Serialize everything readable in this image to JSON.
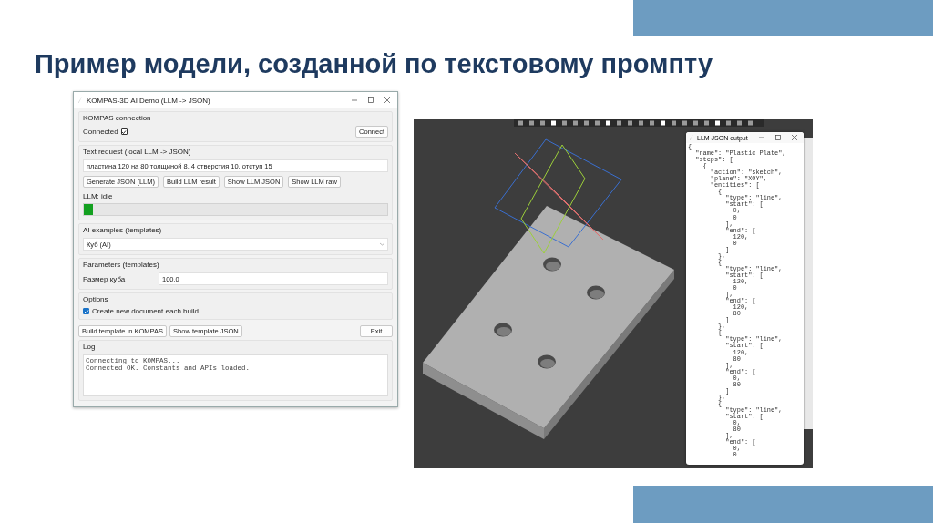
{
  "slide_title": "Пример модели, созданной по текстовому промпту",
  "app_window": {
    "title": "KOMPAS-3D AI Demo (LLM -> JSON)",
    "connection": {
      "heading": "KOMPAS connection",
      "label": "Connected",
      "checked": true,
      "button": "Connect"
    },
    "text_request": {
      "heading": "Text request (local LLM -> JSON)",
      "value": "пластина 120 на 80 толщиной 8, 4 отверстия 10, отступ 15",
      "buttons": [
        "Generate JSON (LLM)",
        "Build LLM result",
        "Show LLM JSON",
        "Show LLM raw"
      ],
      "status": "LLM: idle",
      "level": 0.03
    },
    "examples": {
      "heading": "AI examples (templates)",
      "value": "Куб (AI)"
    },
    "parameters": {
      "heading": "Parameters (templates)",
      "label": "Размер куба",
      "value": "100.0"
    },
    "options": {
      "heading": "Options",
      "label": "Create new document each build",
      "checked": true
    },
    "buttons": [
      "Build template in KOMPAS",
      "Show template JSON",
      "Exit"
    ],
    "log": {
      "heading": "Log",
      "lines": [
        "Connecting to KOMPAS...",
        "Connected OK. Constants and APIs loaded."
      ]
    }
  },
  "json_window": {
    "title": "LLM JSON output",
    "lines": [
      "{",
      "  \"name\": \"Plastic Plate\",",
      "  \"steps\": [",
      "    {",
      "      \"action\": \"sketch\",",
      "      \"plane\": \"XOY\",",
      "      \"entities\": [",
      "        {",
      "          \"type\": \"line\",",
      "          \"start\": [",
      "            0,",
      "            0",
      "          ],",
      "          \"end\": [",
      "            120,",
      "            0",
      "          ]",
      "        },",
      "        {",
      "          \"type\": \"line\",",
      "          \"start\": [",
      "            120,",
      "            0",
      "          ],",
      "          \"end\": [",
      "            120,",
      "            80",
      "          ]",
      "        },",
      "        {",
      "          \"type\": \"line\",",
      "          \"start\": [",
      "            120,",
      "            80",
      "          ],",
      "          \"end\": [",
      "            0,",
      "            80",
      "          ]",
      "        },",
      "        {",
      "          \"type\": \"line\",",
      "          \"start\": [",
      "            0,",
      "            80",
      "          ],",
      "          \"end\": [",
      "            0,",
      "            0"
    ]
  }
}
